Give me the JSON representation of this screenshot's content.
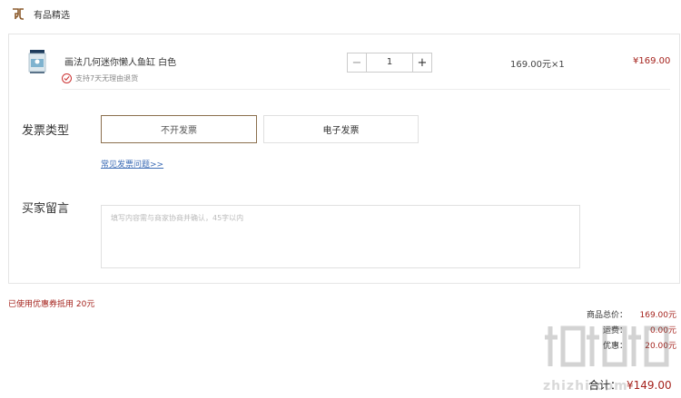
{
  "header": {
    "title": "有品精选"
  },
  "product": {
    "name": "画法几何迷你懒人鱼缸 白色",
    "return_policy": "支持7天无理由退货",
    "quantity": "1",
    "unit_price": "169.00元×1",
    "line_total": "¥169.00",
    "minus_symbol": "−",
    "plus_symbol": "+"
  },
  "invoice": {
    "label": "发票类型",
    "options": [
      "不开发票",
      "电子发票"
    ],
    "selected": "不开发票",
    "faq_link": "常见发票问题>>"
  },
  "message": {
    "label": "买家留言",
    "placeholder": "填写内容需与商家协商并确认，45字以内"
  },
  "coupon_note": "已使用优惠券抵用 20元",
  "summary": {
    "goods_total_label": "商品总价：",
    "goods_total_value": "169.00元",
    "shipping_label": "运费：",
    "shipping_value": "0.00元",
    "discount_label": "优惠：",
    "discount_value": "20.00元",
    "grand_label": "合计：",
    "grand_value": "¥149.00"
  },
  "watermark": {
    "text": "zhizhi.com"
  },
  "colors": {
    "accent_red": "#a5231d",
    "selected_border": "#8b6f4e",
    "link_blue": "#3b6bb5"
  }
}
